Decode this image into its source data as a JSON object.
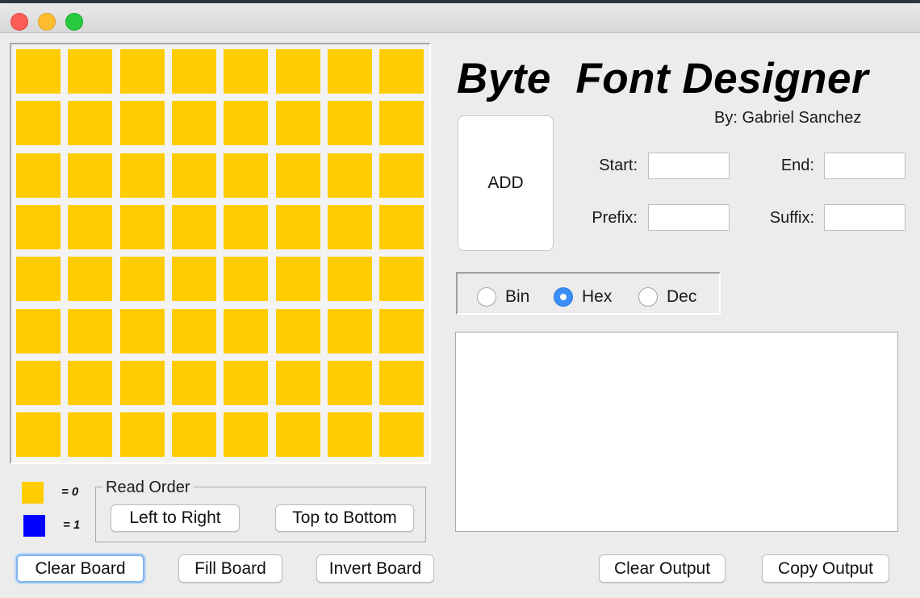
{
  "window": {
    "title": ""
  },
  "colors": {
    "off": "#ffcc00",
    "on": "#0000ff"
  },
  "grid": {
    "rows": 8,
    "cols": 8,
    "cells": [
      [
        0,
        0,
        0,
        0,
        0,
        0,
        0,
        0
      ],
      [
        0,
        0,
        0,
        0,
        0,
        0,
        0,
        0
      ],
      [
        0,
        0,
        0,
        0,
        0,
        0,
        0,
        0
      ],
      [
        0,
        0,
        0,
        0,
        0,
        0,
        0,
        0
      ],
      [
        0,
        0,
        0,
        0,
        0,
        0,
        0,
        0
      ],
      [
        0,
        0,
        0,
        0,
        0,
        0,
        0,
        0
      ],
      [
        0,
        0,
        0,
        0,
        0,
        0,
        0,
        0
      ],
      [
        0,
        0,
        0,
        0,
        0,
        0,
        0,
        0
      ]
    ]
  },
  "legend": {
    "zero_label": "= 0",
    "one_label": "= 1"
  },
  "read_order": {
    "title": "Read Order",
    "left_to_right": "Left to Right",
    "top_to_bottom": "Top to Bottom"
  },
  "bottom_left": {
    "clear_board": "Clear Board",
    "fill_board": "Fill Board",
    "invert_board": "Invert Board"
  },
  "header": {
    "title": "Byte  Font Designer",
    "author": "By: Gabriel Sanchez"
  },
  "add_button": "ADD",
  "fields": {
    "start": {
      "label": "Start:",
      "value": ""
    },
    "end": {
      "label": "End:",
      "value": ""
    },
    "prefix": {
      "label": "Prefix:",
      "value": ""
    },
    "suffix": {
      "label": "Suffix:",
      "value": ""
    }
  },
  "format": {
    "options": [
      "Bin",
      "Hex",
      "Dec"
    ],
    "selected": "Hex"
  },
  "output": {
    "text": ""
  },
  "bottom_right": {
    "clear_output": "Clear Output",
    "copy_output": "Copy Output"
  }
}
